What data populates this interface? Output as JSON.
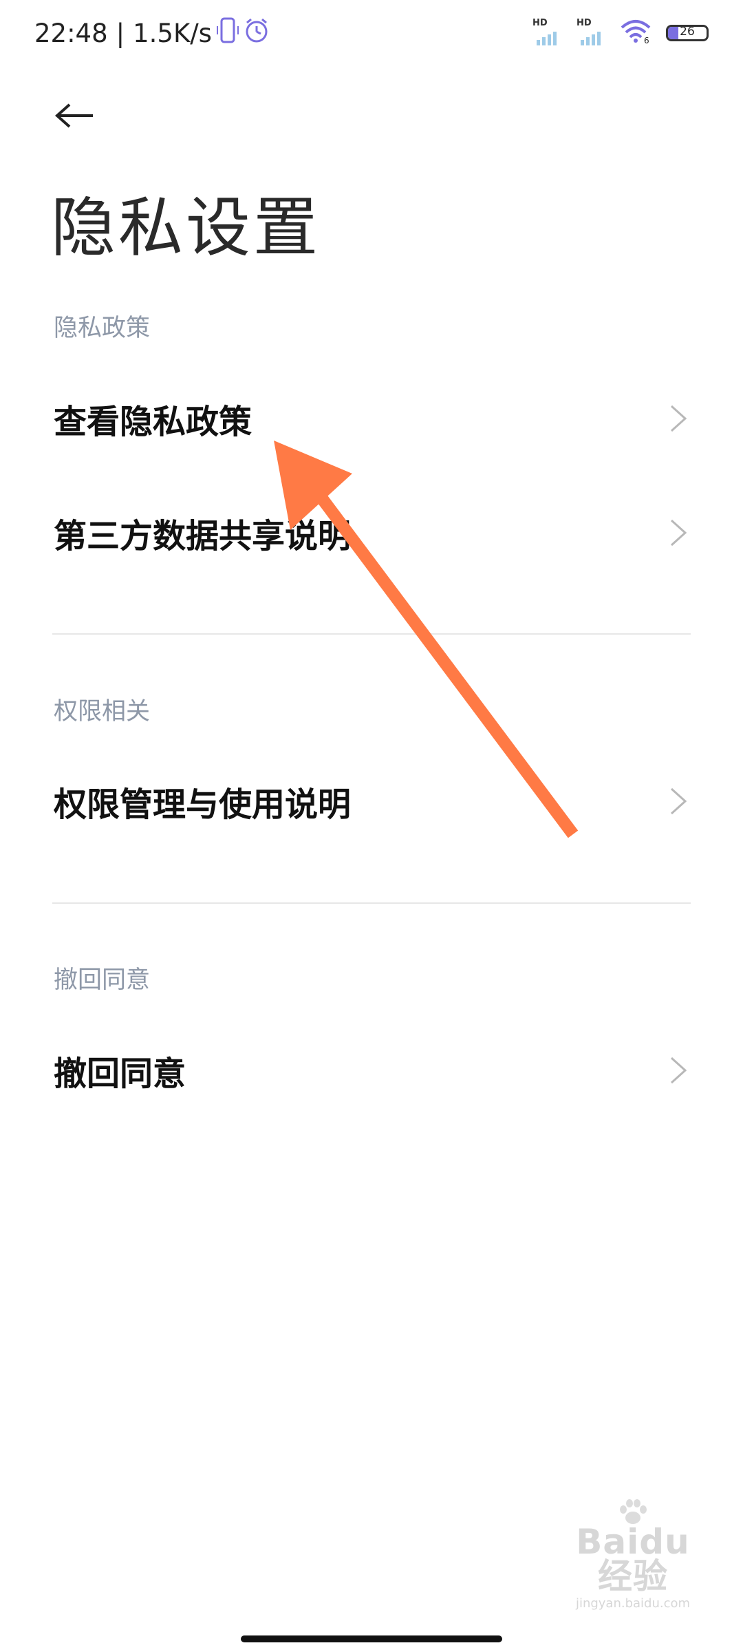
{
  "status_bar": {
    "time": "22:48",
    "separator": "|",
    "net_speed": "1.5K/s",
    "battery_level": "26",
    "battery_fraction": 0.26,
    "signal_label_1": "HD",
    "signal_label_2": "HD",
    "wifi_badge": "6",
    "accent_color": "#7a6ee0",
    "icons": [
      "phone-vibrate-icon",
      "alarm-icon",
      "signal-icon",
      "signal-icon",
      "wifi-icon",
      "battery-icon"
    ]
  },
  "header": {
    "back_icon": "back-arrow-icon",
    "title": "隐私设置"
  },
  "sections": [
    {
      "header": "隐私政策",
      "items": [
        {
          "label": "查看隐私政策",
          "icon": "chevron-right-icon"
        },
        {
          "label": "第三方数据共享说明",
          "icon": "chevron-right-icon"
        }
      ]
    },
    {
      "header": "权限相关",
      "items": [
        {
          "label": "权限管理与使用说明",
          "icon": "chevron-right-icon"
        }
      ]
    },
    {
      "header": "撤回同意",
      "items": [
        {
          "label": "撤回同意",
          "icon": "chevron-right-icon"
        }
      ]
    }
  ],
  "annotation": {
    "color": "#ff7a45",
    "icon": "annotation-arrow-icon"
  },
  "watermark": {
    "brand": "Baidu经验",
    "url": "jingyan.baidu.com"
  }
}
